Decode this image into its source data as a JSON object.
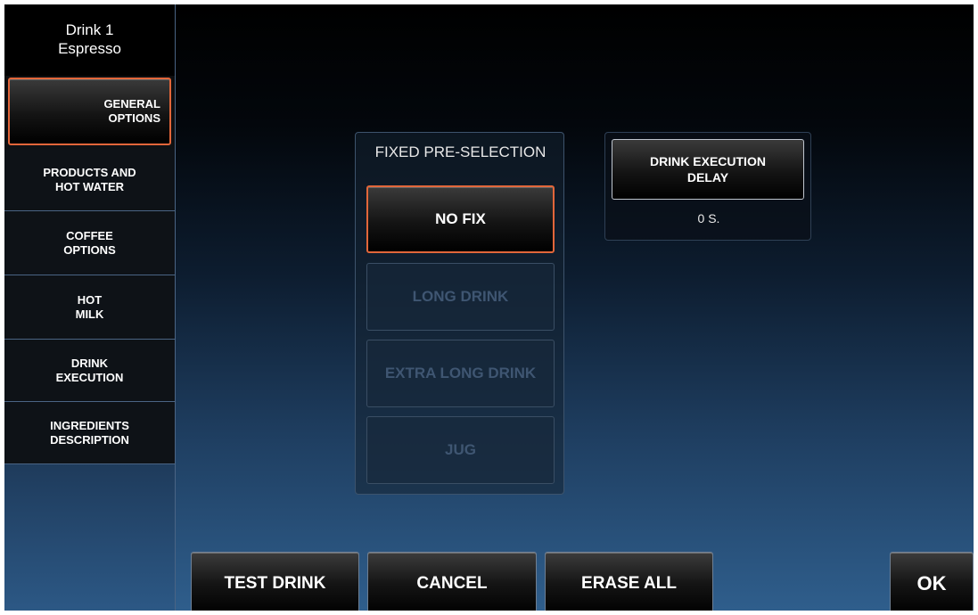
{
  "drink": {
    "line1": "Drink 1",
    "line2": "Espresso"
  },
  "sidebar": {
    "items": [
      {
        "label": "GENERAL\nOPTIONS",
        "active": true
      },
      {
        "label": "PRODUCTS AND\nHOT WATER",
        "active": false
      },
      {
        "label": "COFFEE\nOPTIONS",
        "active": false
      },
      {
        "label": "HOT\nMILK",
        "active": false
      },
      {
        "label": "DRINK\nEXECUTION",
        "active": false
      },
      {
        "label": "INGREDIENTS\nDESCRIPTION",
        "active": false
      }
    ]
  },
  "fixed_preselection": {
    "title": "FIXED PRE-SELECTION",
    "options": [
      {
        "label": "NO FIX",
        "selected": true,
        "enabled": true
      },
      {
        "label": "LONG DRINK",
        "selected": false,
        "enabled": false
      },
      {
        "label": "EXTRA LONG DRINK",
        "selected": false,
        "enabled": false
      },
      {
        "label": "JUG",
        "selected": false,
        "enabled": false
      }
    ]
  },
  "execution_delay": {
    "button_label": "DRINK EXECUTION\nDELAY",
    "value": "0 S."
  },
  "footer": {
    "test_drink": "TEST DRINK",
    "cancel": "CANCEL",
    "erase_all": "ERASE ALL",
    "ok": "OK"
  },
  "colors": {
    "highlight": "#e2663a",
    "background_top": "#000000",
    "background_bottom": "#2f5e8c"
  }
}
